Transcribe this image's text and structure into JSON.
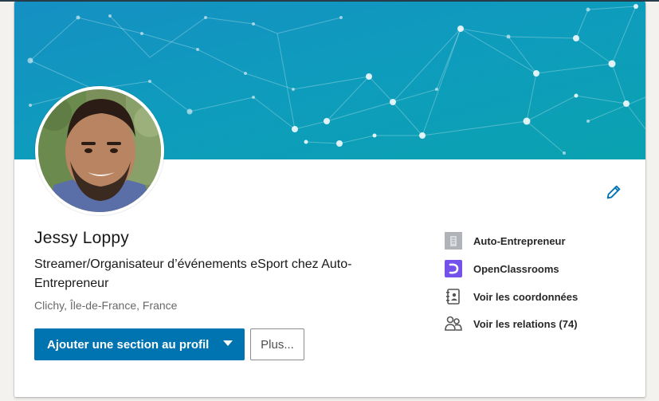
{
  "profile": {
    "name": "Jessy Loppy",
    "headline": "Streamer/Organisateur d’événements eSport chez Auto-Entrepreneur",
    "location": "Clichy, Île-de-France, France"
  },
  "actions": {
    "add_section_label": "Ajouter une section au profil",
    "more_label": "Plus..."
  },
  "sidebar": {
    "items": [
      {
        "label": "Auto-Entrepreneur",
        "icon": "company-building-icon"
      },
      {
        "label": "OpenClassrooms",
        "icon": "openclassrooms-logo-icon"
      },
      {
        "label": "Voir les coordonnées",
        "icon": "contact-card-icon"
      },
      {
        "label": "Voir les relations (74)",
        "icon": "connections-icon"
      }
    ]
  },
  "colors": {
    "primary": "#0073b1",
    "banner_start": "#1a93c5",
    "banner_end": "#0a9fb5",
    "openclassrooms": "#7451eb"
  }
}
